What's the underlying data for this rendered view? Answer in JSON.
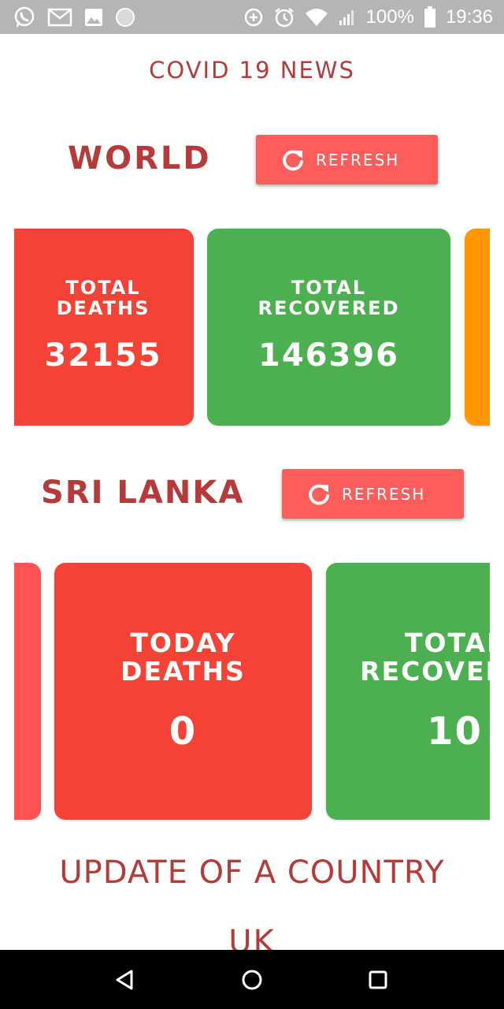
{
  "status_bar": {
    "left_icons": [
      "whatsapp-icon",
      "gmail-icon",
      "image-icon",
      "circle-icon"
    ],
    "right_icons": [
      "data-saver-icon",
      "alarm-icon",
      "wifi-icon",
      "signal-icon",
      "battery-icon"
    ],
    "battery": "100%",
    "time": "19:36"
  },
  "app": {
    "title": "COVID 19 NEWS",
    "world": {
      "heading": "WORLD",
      "refresh_label": "REFRESH",
      "cards": [
        {
          "label_line1": "TOTAL",
          "label_line2": "DEATHS",
          "value": "32155",
          "color": "#f44336"
        },
        {
          "label_line1": "TOTAL",
          "label_line2": "RECOVERED",
          "value": "146396",
          "color": "#4caf50"
        },
        {
          "color": "#ff9800"
        }
      ]
    },
    "sri_lanka": {
      "heading": "SRI LANKA",
      "refresh_label": "REFRESH",
      "cards": [
        {
          "color": "#ff5252"
        },
        {
          "label_line1": "TODAY",
          "label_line2": "DEATHS",
          "value": "0",
          "color": "#f44336"
        },
        {
          "label_line1": "TOTAL",
          "label_line2": "RECOVERED",
          "value": "10",
          "color": "#4caf50"
        }
      ]
    },
    "update_heading": "UPDATE OF A COUNTRY",
    "country_name": "UK"
  },
  "nav_bar": {
    "buttons": [
      "back-icon",
      "home-icon",
      "recents-icon"
    ]
  }
}
